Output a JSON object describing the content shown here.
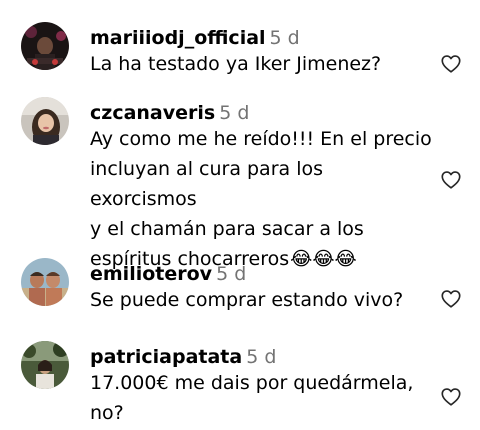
{
  "comments": [
    {
      "username": "mariiiodj_official",
      "time": "5 d",
      "text": "La ha testado ya Iker Jimenez?",
      "avatar_icon": "dj-avatar",
      "like_icon": "heart-outline-icon"
    },
    {
      "username": "czcanaveris",
      "time": "5 d",
      "text": "Ay como me he reído!!! En el precio\nincluyan al cura para los exorcismos\ny el chamán para sacar a los\nespíritus chocarreros",
      "emoji": "😂😂😂",
      "avatar_icon": "woman-avatar",
      "like_icon": "heart-outline-icon"
    },
    {
      "username": "emilioterov",
      "time": "5 d",
      "text": "Se puede comprar estando vivo?",
      "avatar_icon": "couple-avatar",
      "like_icon": "heart-outline-icon"
    },
    {
      "username": "patriciapatata",
      "time": "5 d",
      "text": "17.000€ me dais por quedármela,\nno?",
      "avatar_icon": "outdoor-avatar",
      "like_icon": "heart-outline-icon"
    }
  ]
}
